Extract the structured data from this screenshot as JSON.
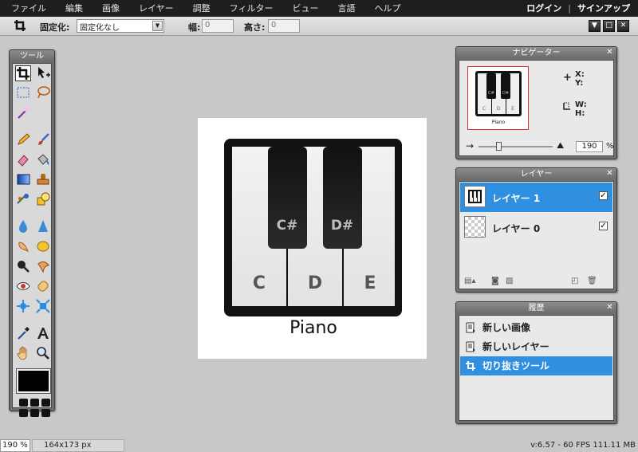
{
  "menubar": {
    "items": [
      "ファイル",
      "編集",
      "画像",
      "レイヤー",
      "調整",
      "フィルター",
      "ビュー",
      "言語",
      "ヘルプ"
    ],
    "login": "ログイン",
    "separator": "|",
    "signup": "サインアップ"
  },
  "options": {
    "constraint_label": "固定化:",
    "constraint_value": "固定化なし",
    "width_label": "幅:",
    "width_value": "0",
    "height_label": "高さ:",
    "height_value": "0"
  },
  "tools": {
    "title": "ツール"
  },
  "canvas": {
    "keys": [
      "C",
      "D",
      "E"
    ],
    "sharps": [
      "C#",
      "D#"
    ],
    "caption": "Piano"
  },
  "navigator": {
    "title": "ナビゲーター",
    "x_label": "X:",
    "y_label": "Y:",
    "w_label": "W:",
    "h_label": "H:",
    "zoom": "190",
    "zoom_unit": "%",
    "zoom_level": 0.25
  },
  "layers": {
    "title": "レイヤー",
    "items": [
      {
        "name": "レイヤー 1",
        "visible": true,
        "active": true
      },
      {
        "name": "レイヤー 0",
        "visible": true,
        "active": false
      }
    ]
  },
  "history": {
    "title": "履歴",
    "items": [
      {
        "label": "新しい画像",
        "active": false
      },
      {
        "label": "新しいレイヤー",
        "active": false
      },
      {
        "label": "切り抜きツール",
        "active": true
      }
    ]
  },
  "status": {
    "zoom": "190 %",
    "size": "164x173 px",
    "fps": "v:6.57 - 60 FPS 111.11 MB"
  },
  "colors": {
    "accent": "#2f8fe0",
    "menubar": "#1e1e1e",
    "workspace": "#c8c8c8"
  }
}
